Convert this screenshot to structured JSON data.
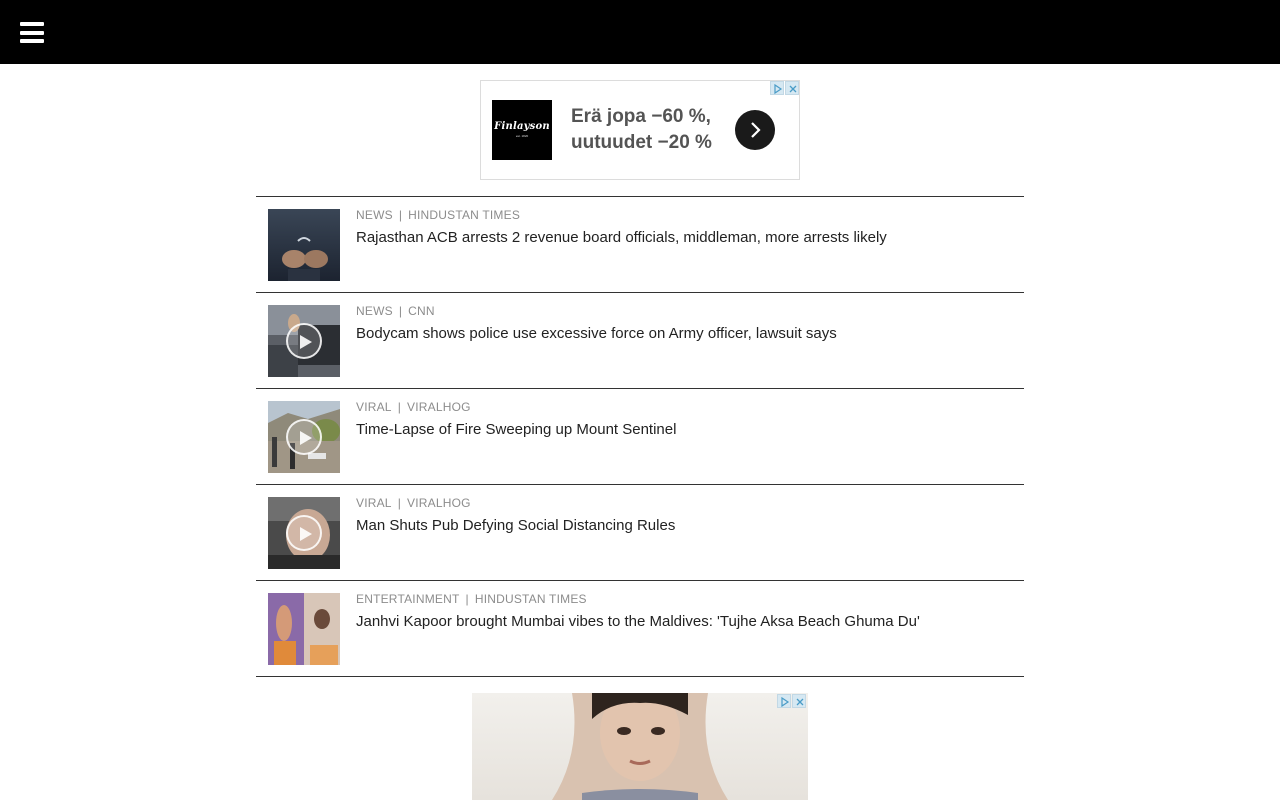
{
  "header": {
    "menu_icon": "hamburger-menu-icon",
    "background": "#000000"
  },
  "ad_top": {
    "brand": "Finlayson",
    "brand_sub": "est. 1820",
    "line1": "Erä jopa −60 %,",
    "line2": "uutuudet −20 %",
    "arrow_icon": "chevron-right-icon",
    "adchoices_icon": "adchoices-icon",
    "close_icon": "close-icon"
  },
  "articles": [
    {
      "category": "NEWS",
      "source": "HINDUSTAN TIMES",
      "title": "Rajasthan ACB arrests 2 revenue board officials, middleman, more arrests likely",
      "video": false
    },
    {
      "category": "NEWS",
      "source": "CNN",
      "title": "Bodycam shows police use excessive force on Army officer, lawsuit says",
      "video": true
    },
    {
      "category": "VIRAL",
      "source": "VIRALHOG",
      "title": "Time-Lapse of Fire Sweeping up Mount Sentinel",
      "video": true
    },
    {
      "category": "VIRAL",
      "source": "VIRALHOG",
      "title": "Man Shuts Pub Defying Social Distancing Rules",
      "video": true
    },
    {
      "category": "ENTERTAINMENT",
      "source": "HINDUSTAN TIMES",
      "title": "Janhvi Kapoor brought Mumbai vibes to the Maldives: 'Tujhe Aksa Beach Ghuma Du'",
      "video": false
    }
  ],
  "ad_bottom": {
    "adchoices_icon": "adchoices-icon",
    "close_icon": "close-icon"
  },
  "colors": {
    "meta_text": "#8c8c8c",
    "title_text": "#222222",
    "divider": "#333333"
  }
}
